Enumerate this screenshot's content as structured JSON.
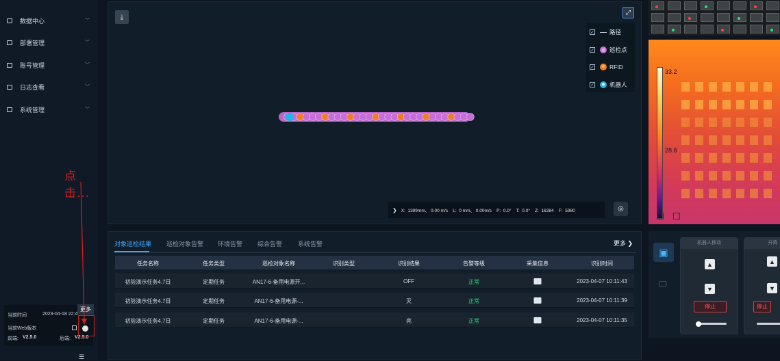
{
  "sidebar": {
    "items": [
      {
        "label": "数据中心",
        "icon": "database-icon"
      },
      {
        "label": "部署管理",
        "icon": "deploy-icon"
      },
      {
        "label": "账号管理",
        "icon": "account-icon"
      },
      {
        "label": "日志查看",
        "icon": "log-icon"
      },
      {
        "label": "系统管理",
        "icon": "settings-icon"
      }
    ],
    "annotation": "点击...",
    "info": {
      "time_label": "当前时间",
      "time_value": "2023-04-18 22:4",
      "web_version_label": "当前Web版本",
      "frontend_label": "前端:",
      "frontend_value": "V2.5.0",
      "backend_label": "后端:",
      "backend_value": "V2.5.0",
      "more_label": "更多"
    }
  },
  "map": {
    "legend": [
      {
        "label": "路径",
        "checked": true,
        "type": "path",
        "color": "#b8c4d0"
      },
      {
        "label": "巡检点",
        "checked": true,
        "type": "dot",
        "color": "#c86ed8"
      },
      {
        "label": "RFID",
        "checked": true,
        "type": "dot",
        "color": "#f07f23"
      },
      {
        "label": "机器人",
        "checked": true,
        "type": "dot",
        "color": "#27b4e3"
      }
    ],
    "coords": "X:  1399mm、 0.00 m/s    L:  0 mm、 0.00m/s    P:  0.0°    T:  0.0°    Z:  16384    F:  5980"
  },
  "thermal": {
    "max_label": "33.2",
    "mid_label": "28.8"
  },
  "results": {
    "tabs": [
      "对象巡检结果",
      "巡检对象告警",
      "环境告警",
      "综合告警",
      "系统告警"
    ],
    "more": "更多 ❯",
    "columns": [
      "任务名称",
      "任务类型",
      "巡检对象名称",
      "识别类型",
      "识别结果",
      "告警等级",
      "采集信息",
      "识别时间"
    ],
    "rows": [
      {
        "task": "初验演示任务4.7日",
        "type": "定期任务",
        "object": "AN17-6-备用电源开...",
        "recog_type": "",
        "result": "OFF",
        "level": "正常",
        "time": "2023-04-07 10:11:43"
      },
      {
        "task": "初验演示任务4.7日",
        "type": "定期任务",
        "object": "AN17-6-备用电源-...",
        "recog_type": "",
        "result": "灭",
        "level": "正常",
        "time": "2023-04-07 10:11:39"
      },
      {
        "task": "初验演示任务4.7日",
        "type": "定期任务",
        "object": "AN17-6-备用电源-...",
        "recog_type": "",
        "result": "亮",
        "level": "正常",
        "time": "2023-04-07 10:11:35"
      }
    ]
  },
  "controls": {
    "robot_move_title": "机器人移动",
    "lift_title": "升降",
    "stop_label": "停止"
  }
}
